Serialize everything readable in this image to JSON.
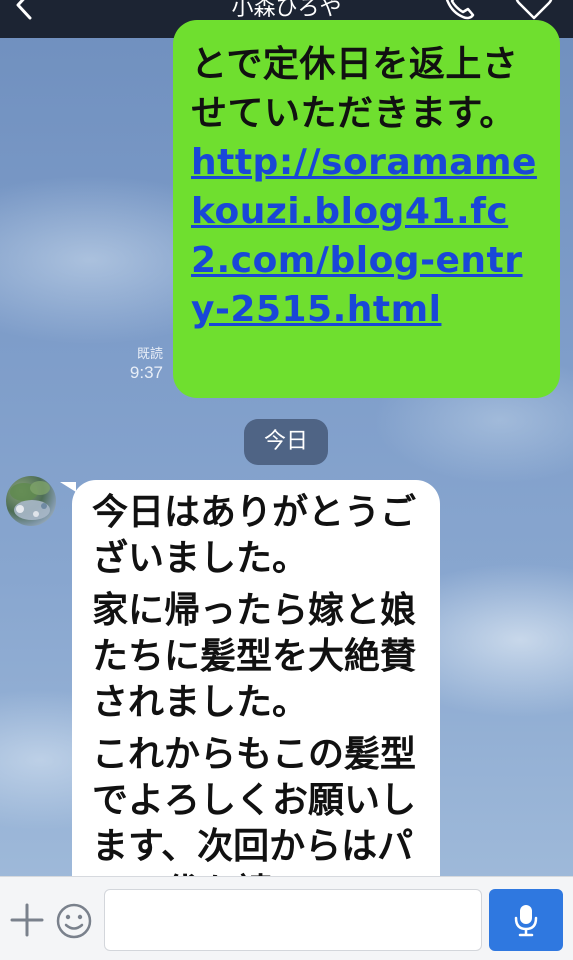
{
  "header": {
    "title": "小森ひろや",
    "back_icon": "chevron-left-icon",
    "call_icon": "phone-icon",
    "favorite_icon": "heart-outline-icon",
    "page_dots": 3,
    "active_page": 1
  },
  "messages": {
    "outgoing": {
      "text_prefix": "とで定休日を返上させていただきます。 ",
      "link": "http://soramamekouzi.blog41.fc2.com/blog-entry-2515.html",
      "read_label": "既読",
      "time": "9:37",
      "bubble_color": "#6fdf2f",
      "link_color": "#1947d8"
    },
    "date_separator": "今日",
    "incoming": {
      "paragraphs": [
        "今日はありがとうございました。",
        "家に帰ったら嫁と娘たちに髪型を大絶賛されました。",
        "これからもこの髪型でよろしくお願いします、次回からはパーマ代を請"
      ]
    }
  },
  "input_bar": {
    "plus_icon": "plus-icon",
    "emoji_icon": "emoji-icon",
    "message_value": "",
    "mic_icon": "microphone-icon",
    "mic_button_color": "#2f78e0"
  }
}
